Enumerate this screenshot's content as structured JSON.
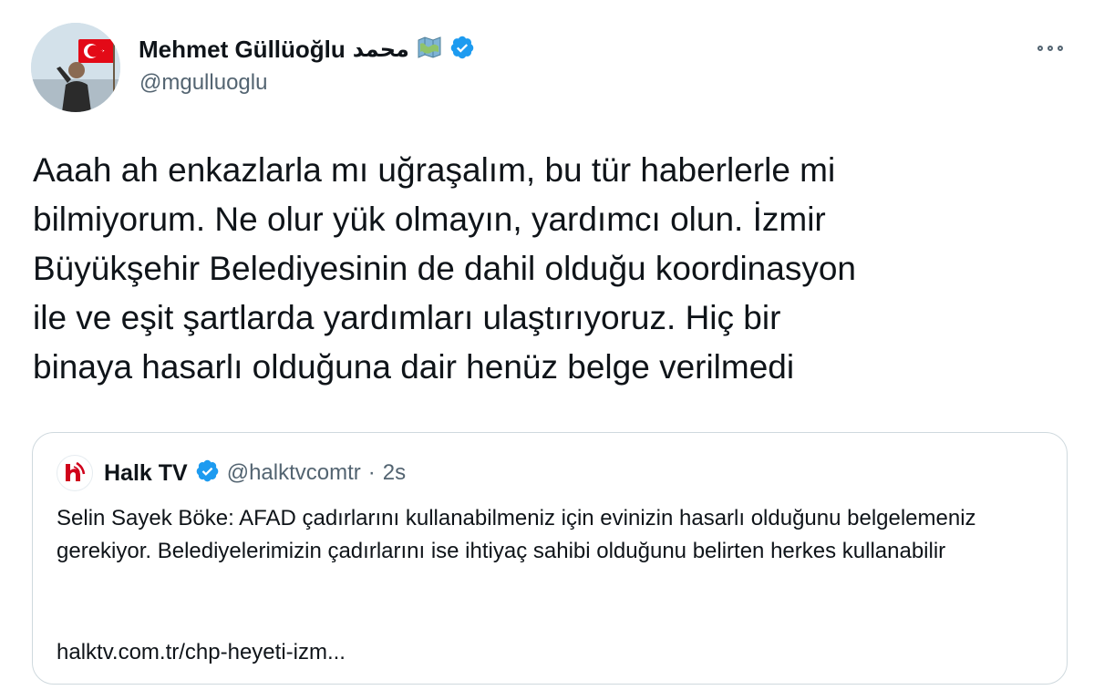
{
  "tweet": {
    "author": {
      "display_name": "Mehmet Güllüoğlu",
      "arabic_name": "محمد",
      "handle": "@mgulluoglu",
      "badge_icon": "map-emoji-icon",
      "verified_icon": "verified-badge-icon"
    },
    "text": "Aaah ah enkazlarla mı uğraşalım, bu tür haberlerle mi\nbilmiyorum. Ne olur yük olmayın, yardımcı olun. İzmir\nBüyükşehir Belediyesinin de dahil olduğu koordinasyon\nile ve eşit şartlarda yardımları ulaştırıyoruz. Hiç bir\nbinaya hasarlı olduğuna dair henüz belge verilmedi"
  },
  "quote": {
    "logo_icon": "halktv-logo-icon",
    "display_name": "Halk TV",
    "handle": "@halktvcomtr",
    "separator": "·",
    "time": "2s",
    "text": "Selin Sayek Böke: AFAD çadırlarını kullanabilmeniz için evinizin hasarlı olduğunu belgelemeniz gerekiyor. Belediyelerimizin çadırlarını ise ihtiyaç sahibi olduğunu belirten herkes kullanabilir",
    "link": "halktv.com.tr/chp-heyeti-izm..."
  },
  "colors": {
    "verified": "#1d9bf0",
    "text_primary": "#0f1419",
    "text_secondary": "#536471",
    "border": "#cfd9de",
    "logo_red": "#d0021b"
  }
}
